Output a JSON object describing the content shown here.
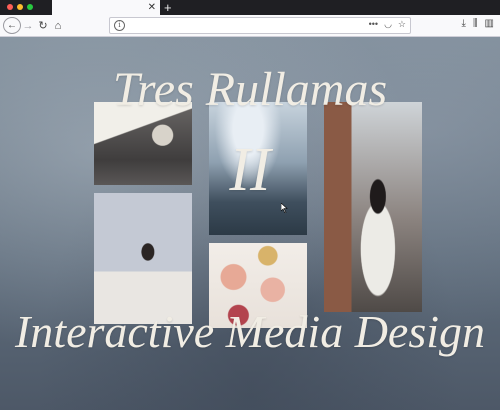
{
  "browser": {
    "tab_title": "",
    "tab_close": "✕",
    "new_tab": "+",
    "url": "",
    "icons": [
      "back-arrow-icon",
      "forward-arrow-icon",
      "reload-icon",
      "home-icon",
      "info-icon",
      "more-icon",
      "pocket-icon",
      "bookmark-star-icon",
      "download-icon",
      "library-icon",
      "sidebar-icon"
    ]
  },
  "page": {
    "title": "Tres Rullamas",
    "numeral": "II",
    "subtitle": "Interactive Media Design"
  },
  "colors": {
    "title_text": "#f1ede4",
    "background": "#6f7e8c"
  }
}
